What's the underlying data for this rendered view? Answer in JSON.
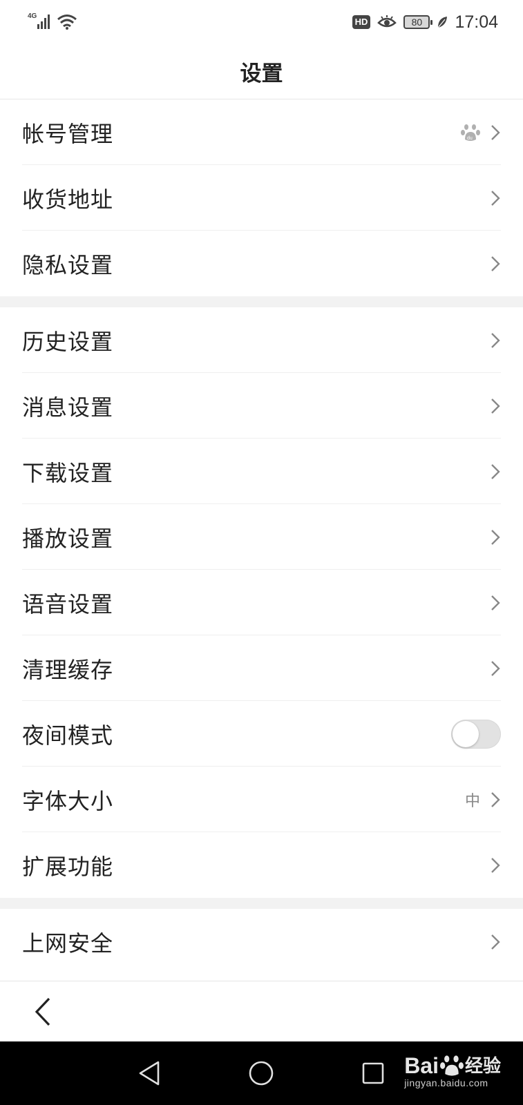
{
  "status_bar": {
    "network": "4G",
    "hd_badge": "HD",
    "battery": "80",
    "time": "17:04"
  },
  "header": {
    "title": "设置"
  },
  "groups": [
    {
      "items": [
        {
          "label": "帐号管理",
          "accessory": "chevron",
          "icon": "baidu-paw-icon"
        },
        {
          "label": "收货地址",
          "accessory": "chevron"
        },
        {
          "label": "隐私设置",
          "accessory": "chevron"
        }
      ]
    },
    {
      "items": [
        {
          "label": "历史设置",
          "accessory": "chevron"
        },
        {
          "label": "消息设置",
          "accessory": "chevron"
        },
        {
          "label": "下载设置",
          "accessory": "chevron"
        },
        {
          "label": "播放设置",
          "accessory": "chevron"
        },
        {
          "label": "语音设置",
          "accessory": "chevron"
        },
        {
          "label": "清理缓存",
          "accessory": "chevron"
        },
        {
          "label": "夜间模式",
          "accessory": "toggle",
          "toggle_on": false
        },
        {
          "label": "字体大小",
          "accessory": "chevron",
          "value": "中"
        },
        {
          "label": "扩展功能",
          "accessory": "chevron"
        }
      ]
    },
    {
      "items": [
        {
          "label": "上网安全",
          "accessory": "chevron"
        }
      ]
    }
  ],
  "bottom_bar": {
    "back_icon": "chevron-left-icon"
  },
  "nav_bar": {
    "back": "triangle-back-icon",
    "home": "circle-home-icon",
    "recents": "square-recents-icon"
  },
  "watermark": {
    "brand": "Bai",
    "brand2": "经验",
    "domain": "jingyan.baidu.com"
  },
  "colors": {
    "background": "#ffffff",
    "section_gap": "#f2f2f2",
    "text": "#222222",
    "secondary": "#888888"
  }
}
